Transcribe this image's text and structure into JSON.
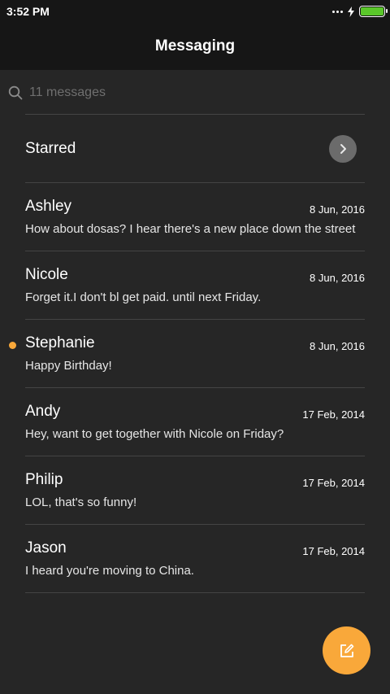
{
  "status_bar": {
    "time": "3:52 PM"
  },
  "header": {
    "title": "Messaging"
  },
  "search": {
    "placeholder": "11 messages"
  },
  "starred": {
    "label": "Starred"
  },
  "messages": [
    {
      "name": "Ashley",
      "date": "8 Jun, 2016",
      "preview": "How about dosas? I hear there's a new place down the street",
      "unread": false
    },
    {
      "name": "Nicole",
      "date": "8 Jun, 2016",
      "preview": "Forget it.I don't bl get paid. until next Friday.",
      "unread": false
    },
    {
      "name": "Stephanie",
      "date": "8 Jun, 2016",
      "preview": "Happy Birthday!",
      "unread": true
    },
    {
      "name": "Andy",
      "date": "17 Feb, 2014",
      "preview": "Hey, want to get together with Nicole on Friday?",
      "unread": false
    },
    {
      "name": "Philip",
      "date": "17 Feb, 2014",
      "preview": "LOL, that's so funny!",
      "unread": false
    },
    {
      "name": "Jason",
      "date": "17 Feb, 2014",
      "preview": "I heard you're moving to China.",
      "unread": false
    }
  ],
  "colors": {
    "accent": "#f9a83a",
    "background": "#262626",
    "bar": "#161616",
    "battery": "#5ac72a"
  },
  "icons": {
    "search": "search-icon",
    "starred_arrow": "chevron-right-icon",
    "compose": "compose-icon"
  }
}
